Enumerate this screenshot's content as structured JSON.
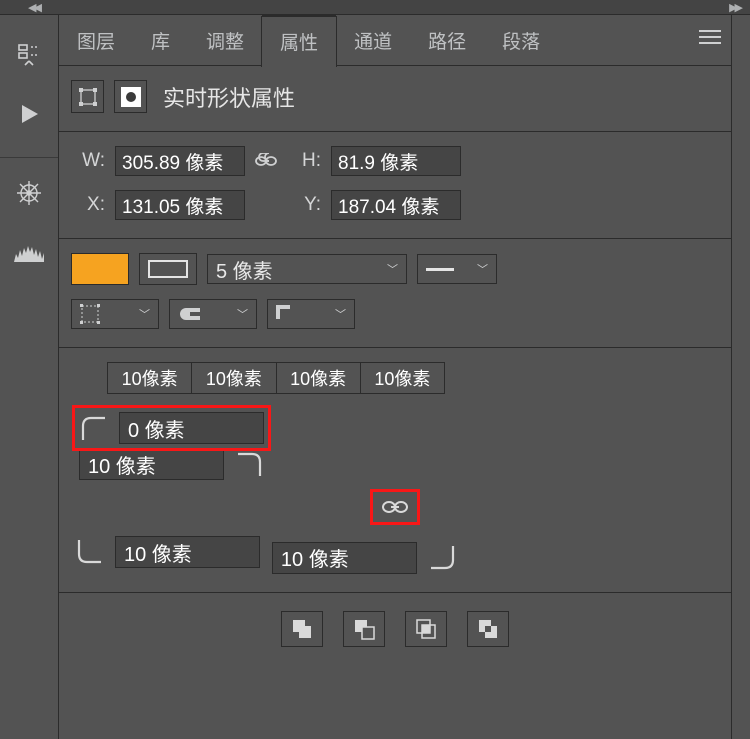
{
  "tabs": {
    "layers": "图层",
    "libraries": "库",
    "adjustments": "调整",
    "properties": "属性",
    "channels": "通道",
    "paths": "路径",
    "paragraph": "段落"
  },
  "header": {
    "title": "实时形状属性"
  },
  "transform": {
    "w_label": "W:",
    "w_value": "305.89 像素",
    "h_label": "H:",
    "h_value": "81.9 像素",
    "x_label": "X:",
    "x_value": "131.05 像素",
    "y_label": "Y:",
    "y_value": "187.04 像素"
  },
  "appearance": {
    "fill": "#f6a320",
    "stroke_width": "5 像素"
  },
  "corners": {
    "combined": [
      "10像素",
      "10像素",
      "10像素",
      "10像素"
    ],
    "tl": "0 像素",
    "tr": "10 像素",
    "bl": "10 像素",
    "br": "10 像素"
  }
}
